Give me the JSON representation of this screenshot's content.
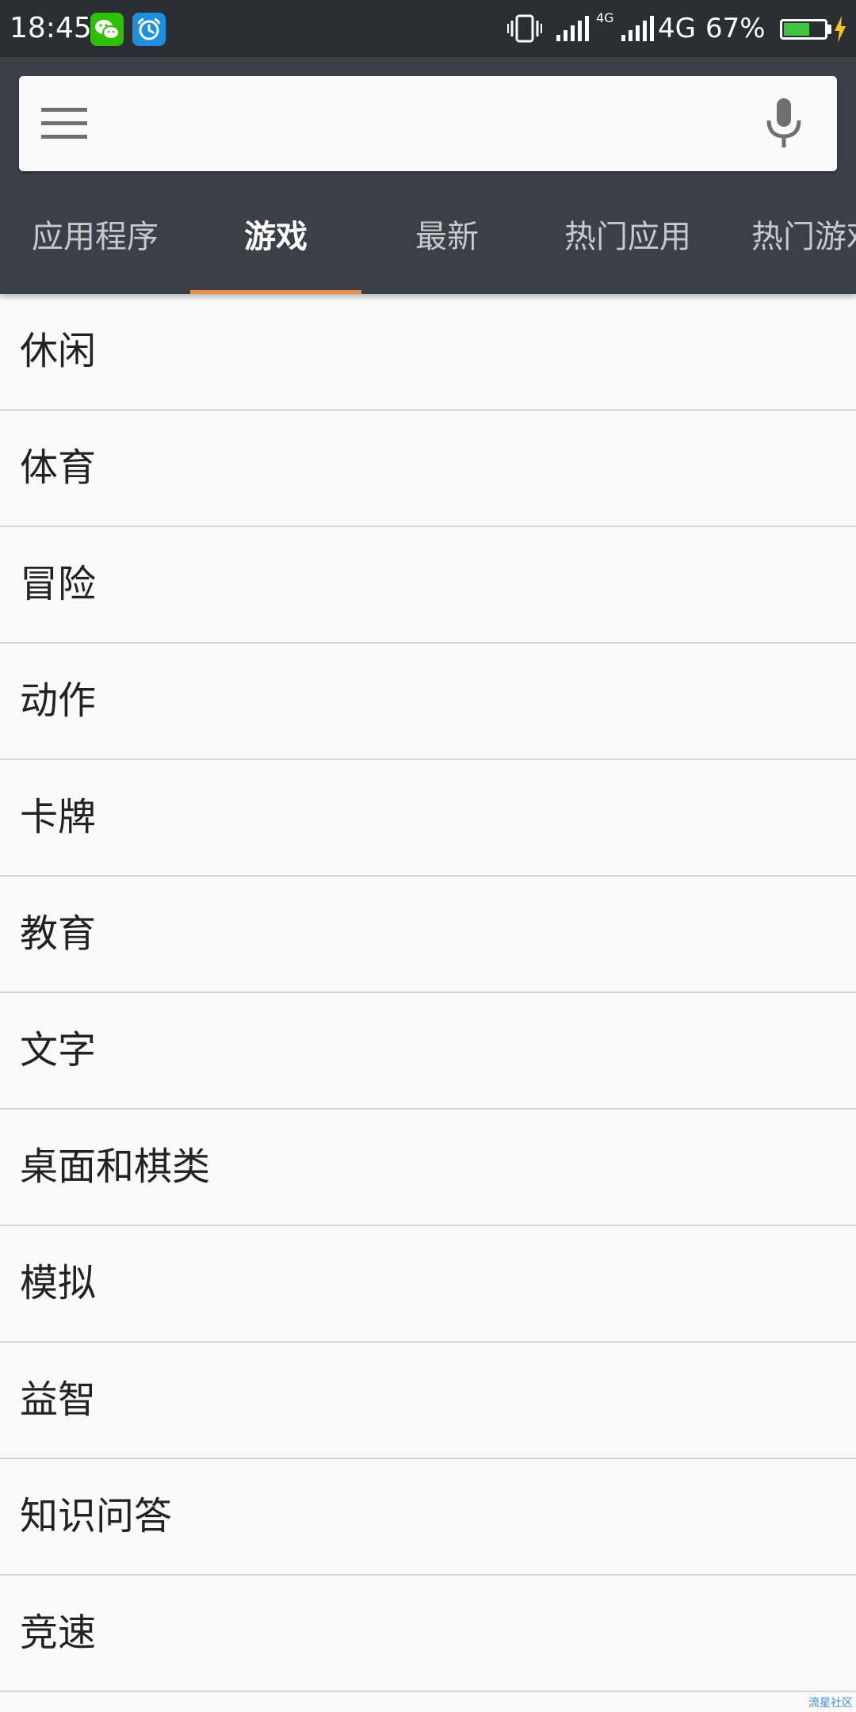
{
  "status_bar": {
    "time": "18:45",
    "notification_icons": [
      "wechat-icon",
      "alarm-icon"
    ],
    "network_small_label": "4G",
    "network_label": "4G",
    "battery_percent": "67%",
    "battery_level": 0.67,
    "battery_color": "#3fc43f",
    "charging": true
  },
  "search": {
    "menu_icon": "hamburger-menu-icon",
    "placeholder": "",
    "mic_icon": "microphone-icon"
  },
  "tabs": [
    {
      "label": "应用程序",
      "active": false
    },
    {
      "label": "游戏",
      "active": true
    },
    {
      "label": "最新",
      "active": false
    },
    {
      "label": "热门应用",
      "active": false
    },
    {
      "label": "热门游戏",
      "active": false
    }
  ],
  "accent_color": "#e8904a",
  "categories": [
    "休闲",
    "体育",
    "冒险",
    "动作",
    "卡牌",
    "教育",
    "文字",
    "桌面和棋类",
    "模拟",
    "益智",
    "知识问答",
    "竞速"
  ],
  "watermark": "流星社区"
}
